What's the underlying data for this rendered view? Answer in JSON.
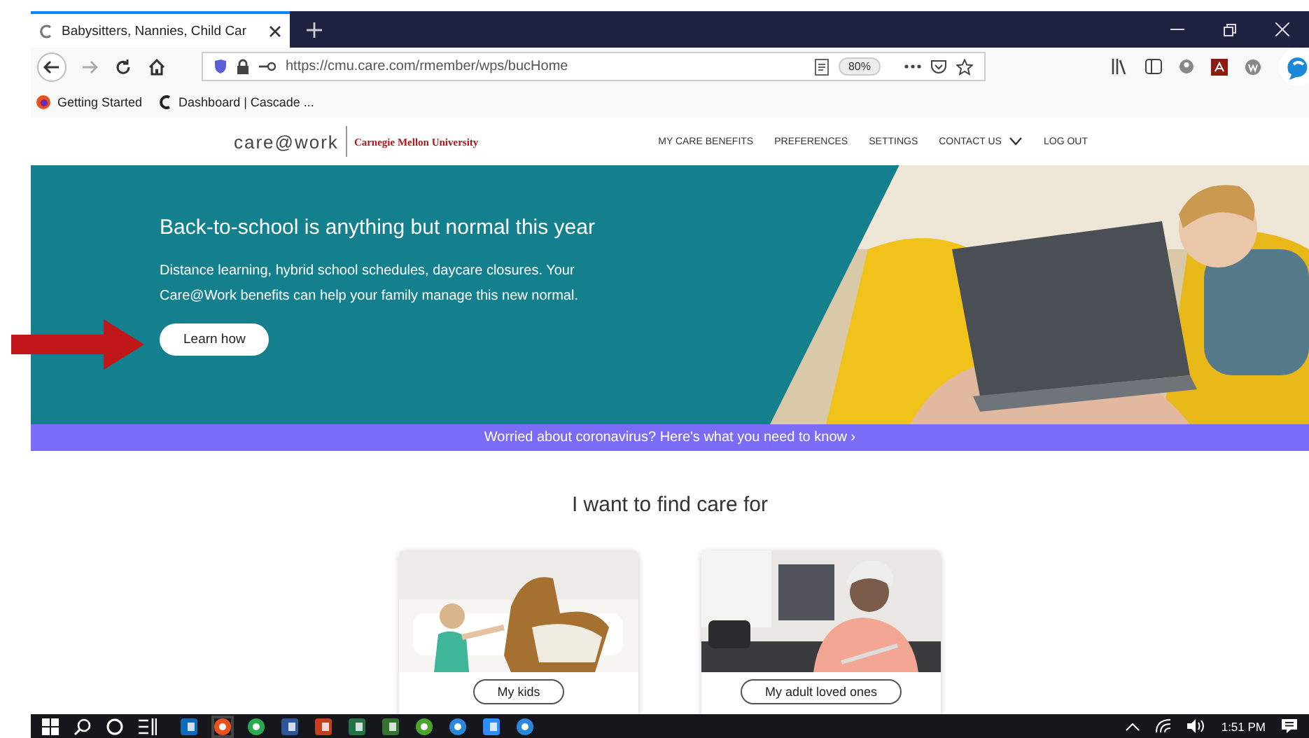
{
  "browser": {
    "tab": {
      "title": "Babysitters, Nannies, Child Car",
      "selected": true
    },
    "address": "https://cmu.care.com/rmember/wps/bucHome",
    "zoom": "80%",
    "bookmarks": [
      {
        "label": "Getting Started"
      },
      {
        "label": "Dashboard | Cascade ..."
      }
    ]
  },
  "header": {
    "logo": "care@work",
    "partner": "Carnegie Mellon University",
    "nav": [
      {
        "label": "MY CARE BENEFITS",
        "kind": "link"
      },
      {
        "label": "PREFERENCES",
        "kind": "link"
      },
      {
        "label": "SETTINGS",
        "kind": "link"
      },
      {
        "label": "CONTACT US",
        "kind": "menu"
      },
      {
        "label": "LOG OUT",
        "kind": "link"
      }
    ]
  },
  "hero": {
    "title": "Back-to-school is anything but normal this year",
    "text": "Distance learning, hybrid school schedules, daycare closures. Your Care@Work benefits can help your family manage this new normal.",
    "button": "Learn how"
  },
  "banner": "Worried about coronavirus? Here's what you need to know ›",
  "find_care": {
    "title": "I want to find care for",
    "cards": [
      {
        "button": "My kids",
        "kind": "picture"
      },
      {
        "button": "My adult loved ones",
        "kind": "picture"
      }
    ]
  },
  "taskbar": {
    "clock": "1:51 PM"
  }
}
